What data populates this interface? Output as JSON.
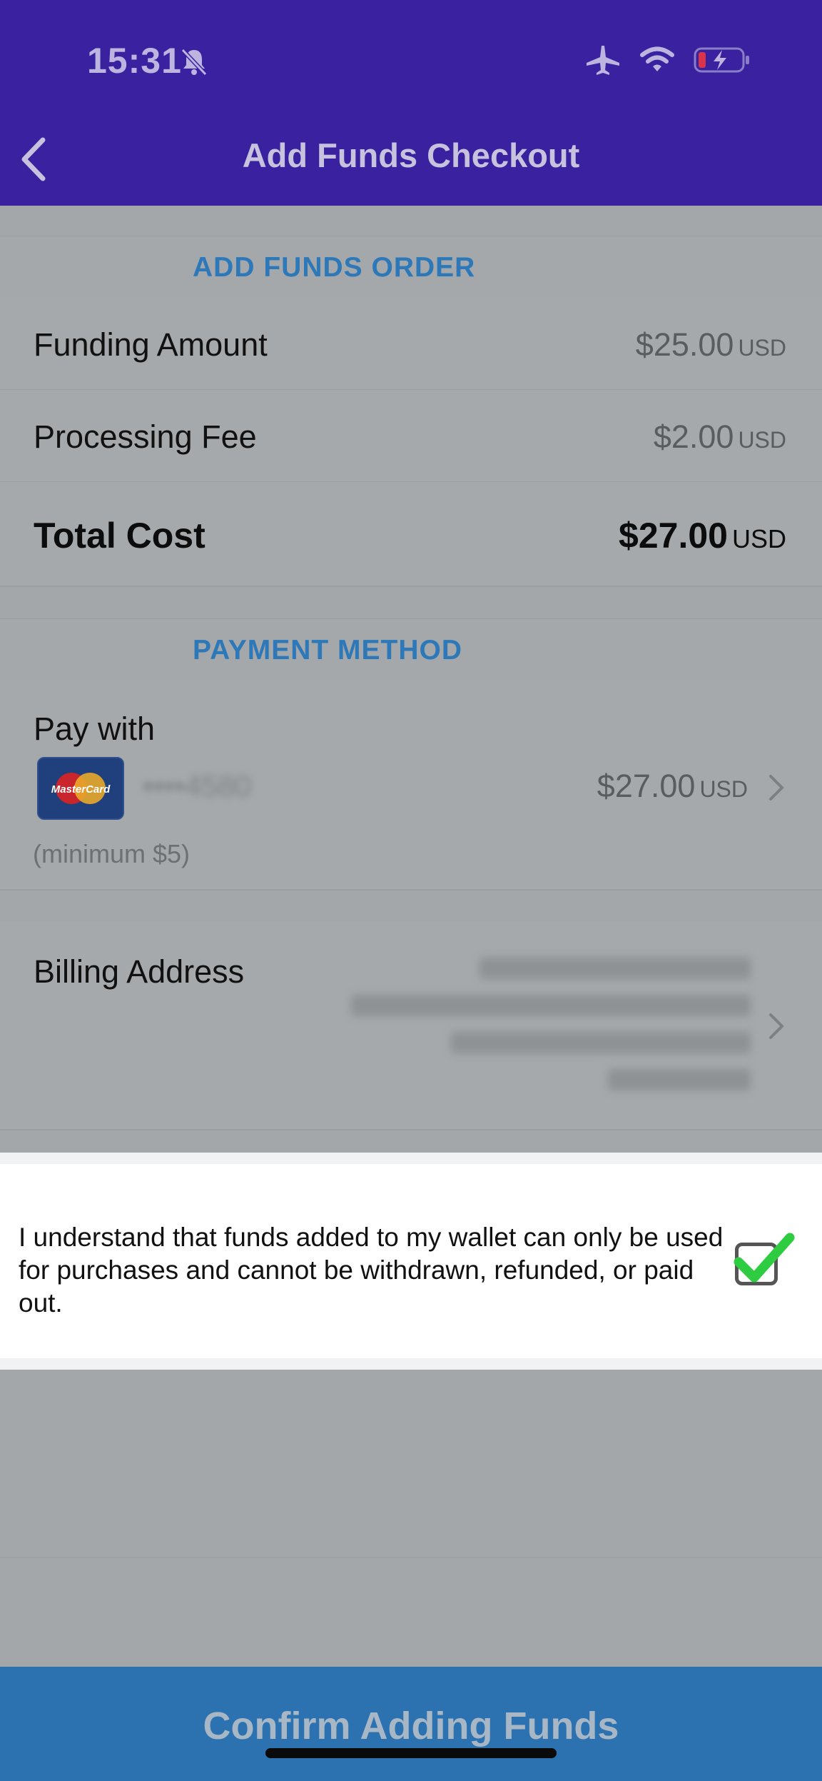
{
  "status_bar": {
    "time": "15:31"
  },
  "header": {
    "title": "Add Funds Checkout"
  },
  "order_section": {
    "heading": "ADD FUNDS ORDER",
    "funding_amount": {
      "label": "Funding Amount",
      "amount": "$25.00",
      "currency": "USD"
    },
    "processing_fee": {
      "label": "Processing Fee",
      "amount": "$2.00",
      "currency": "USD"
    },
    "total_cost": {
      "label": "Total Cost",
      "amount": "$27.00",
      "currency": "USD"
    }
  },
  "payment_section": {
    "heading": "PAYMENT METHOD",
    "pay_with_label": "Pay with",
    "card_brand": "MasterCard",
    "amount": "$27.00",
    "currency": "USD",
    "minimum_note": "(minimum $5)"
  },
  "billing": {
    "label": "Billing Address"
  },
  "consent": {
    "text": "I understand that funds added to my wallet can only be used for purchases and cannot be withdrawn, refunded, or paid out.",
    "checked": true
  },
  "confirm_button": {
    "label": "Confirm Adding Funds"
  },
  "colors": {
    "header": "#3a21a0",
    "accent": "#2d78b8",
    "button": "#2c72b0",
    "check": "#2ecc40"
  }
}
